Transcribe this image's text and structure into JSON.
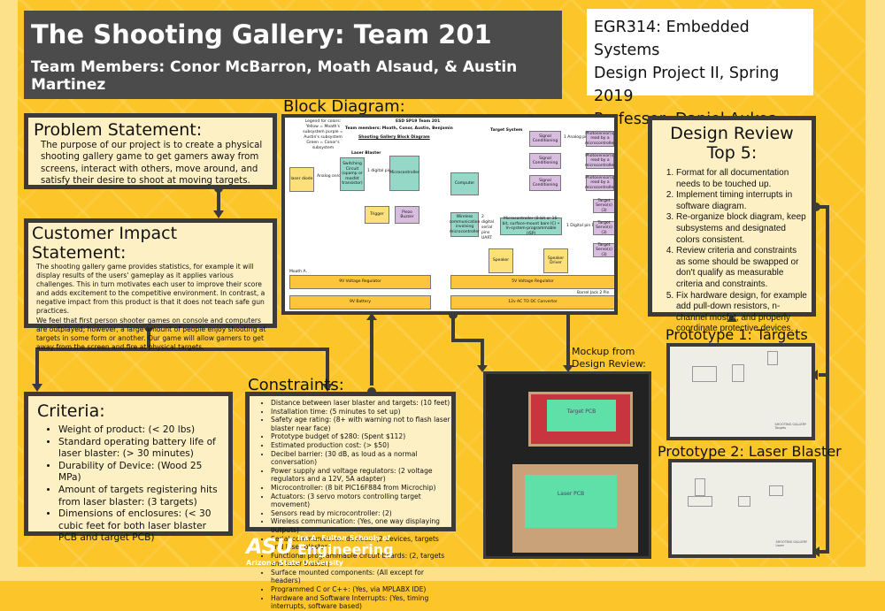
{
  "header": {
    "title": "The Shooting Gallery: Team 201",
    "members": "Team Members: Conor McBarron, Moath Alsaud, & Austin Martinez"
  },
  "course": {
    "line1": "EGR314: Embedded Systems",
    "line2": "Design Project II, Spring 2019",
    "line3": "Professor, Daniel Aukes"
  },
  "problem": {
    "title": "Problem Statement:",
    "text": "The purpose of our project is to create a physical shooting gallery game to get gamers away from screens, interact with others, move around, and satisfy their desire to shoot at moving targets."
  },
  "impact": {
    "title": "Customer Impact Statement:",
    "p1": "The shooting gallery game provides statistics, for example it will display results of the users' gameplay as it applies various challenges. This in turn motivates each user to improve their score and adds excitement to the competitive environment. In contrast, a negative impact from this product is that it does not teach safe gun practices.",
    "p2": "We feel that first person shooter games on console and computers are outplayed; however, a large amount of people enjoy shooting at targets in some form or another. Our game will allow gamers to get away from the screen and fire at physical targets."
  },
  "criteria": {
    "title": "Criteria:",
    "items": [
      "Weight of product: (< 20 lbs)",
      "Standard operating battery life of laser blaster: (> 30 minutes)",
      "Durability of Device: (Wood 25 MPa)",
      "Amount of targets registering hits from laser blaster: (3 targets)",
      "Dimensions of enclosures: (< 30 cubic feet for both laser blaster PCB and target PCB)"
    ]
  },
  "constraints": {
    "title": "Constraints:",
    "items": [
      "Distance between laser blaster and targets: (10 feet)",
      "Installation time: (5 minutes to set up)",
      "Safety age rating: (8+ with warning not to flash laser blaster near face)",
      "Prototype budget of $280: (Spent $112)",
      "Estimated production cost: (> $50)",
      "Decibel barrier: (30 dB, as loud as a normal conversation)",
      "Power supply and voltage regulators: (2 voltage regulators and a 12V, 5A adapter)",
      "Microcontroller: (8 bit PIC16F884 from Microchip)",
      "Actuators: (3 servo motors controlling target movement)",
      "Sensors read by microcontroller: (2)",
      "Wireless communication: (Yes, one way displaying outputs)",
      "Serial communication devices: (2 devices, targets and laser blaster)",
      "Functional programmable circuit boards: (2, targets and laser blaster)",
      "Surface mounted components: (All except for headers)",
      "Programmed C or C++: (Yes, via MPLABX IDE)",
      "Hardware and Software Interrupts: (Yes, timing interrupts, software based)"
    ]
  },
  "design_review": {
    "title": "Design Review Top 5:",
    "items": [
      "Format for all documentation needs to be touched up.",
      "Implement timing interrupts in software diagram.",
      "Re-organize block diagram, keep subsystems and designated colors consistent.",
      "Review criteria and constraints as some should be swapped or don't qualify as measurable criteria and constraints.",
      "Fix hardware design, for example add pull-down resistors, n-channel mosfet, and properly coordinate protective devices."
    ]
  },
  "block_diagram": {
    "label": "Block Diagram:",
    "header": "ESD SP19 Team 201",
    "team": "Team members: Moath, Conor, Austin, Benjamin",
    "title": "Shooting Gallery Block Diagram",
    "legend": "Legend for colors: Yellow = Moath's subsystem purple = Austin's subsystem Green = Conor's subsystem",
    "laser_section": "Laser Blaster",
    "target_section": "Target System",
    "blocks": {
      "laser_diode": "laser diode",
      "switching": "Switching Circuit (opamp or mosfet transistor)",
      "mcu": "Microcontroller",
      "trigger": "Trigger",
      "buzzer": "Piezo Buzzer",
      "computer": "Computer",
      "wireless": "Wireless communication involving microcontroller",
      "target_mcu": "Microcontroller (8-bit or 16-bit, surface-mount bare IC) • In-system-programmable (ISP)",
      "speaker": "Speaker",
      "speaker_driver": "Speaker Driver",
      "signal": "Signal Conditioning",
      "photo": "Photosensor(s) read by a microcontroller",
      "servo": "Target Servo(s) (3)",
      "reg9": "9V Voltage Regulator",
      "battery": "9V Battery",
      "reg5": "5V Voltage Regulator",
      "conv": "12v AC TO DC Convertor"
    },
    "labels": {
      "moath": "Moath A.",
      "conor": "Conor",
      "austin": "Austin",
      "analog_onoff": "Analog on/off",
      "digital1": "1 digital pin",
      "analog1": "1 Analog pin",
      "uart": "2 digital serial pins UART",
      "pwm": "1 Digital pin PWM",
      "barrel": "Barrel Jack 2 Pin"
    }
  },
  "mockup": {
    "label": "Mockup from Design Review:",
    "target_text": "Target PCB",
    "laser_text": "Laser PCB"
  },
  "prototype1": {
    "label": "Prototype 1: Targets",
    "sheet_title": "SHOOTING GALLERY",
    "sheet_name": "Targets"
  },
  "prototype2": {
    "label": "Prototype 2: Laser Blaster",
    "sheet_title": "SHOOTING GALLERY",
    "sheet_name": "Laser"
  },
  "logo": {
    "mark": "ASU",
    "school": "Ira A. Fulton Schools of",
    "engineering": "Engineering",
    "university": "Arizona State University"
  },
  "colors": {
    "background": "#fcc52a",
    "panel": "#fdf0c4",
    "header": "#4b4b4b",
    "border": "#3b3b3b"
  }
}
